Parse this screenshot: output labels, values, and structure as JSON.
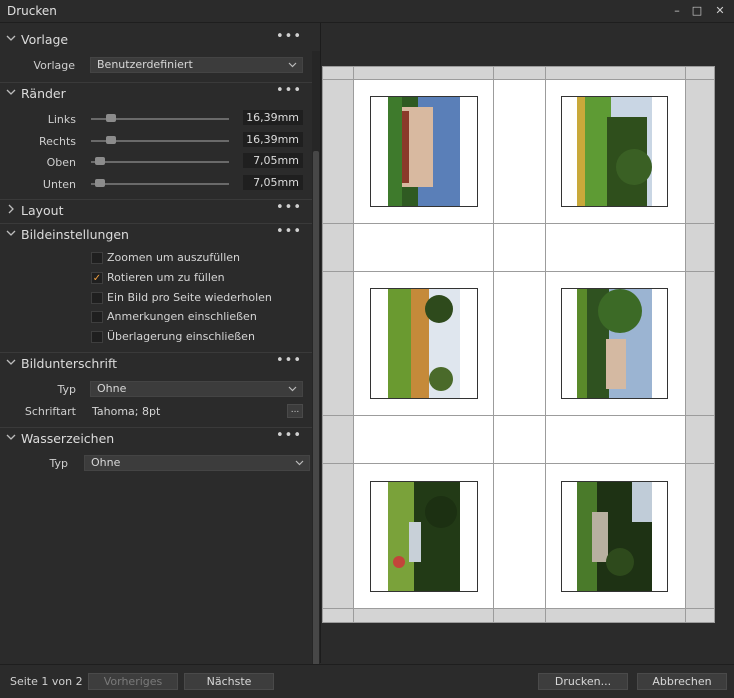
{
  "window": {
    "title": "Drucken",
    "minimize": "–",
    "maximize": "□",
    "close": "✕"
  },
  "panel": {
    "vorlage": {
      "title": "Vorlage",
      "menu": "•••",
      "field_label": "Vorlage",
      "value": "Benutzerdefiniert"
    },
    "raender": {
      "title": "Ränder",
      "menu": "•••",
      "rows": [
        {
          "label": "Links",
          "value": "16,39mm",
          "level": 0.12
        },
        {
          "label": "Rechts",
          "value": "16,39mm",
          "level": 0.12
        },
        {
          "label": "Oben",
          "value": "7,05mm",
          "level": 0.04
        },
        {
          "label": "Unten",
          "value": "7,05mm",
          "level": 0.04
        }
      ]
    },
    "layout": {
      "title": "Layout",
      "menu": "•••"
    },
    "bildeinstellungen": {
      "title": "Bildeinstellungen",
      "menu": "•••",
      "options": [
        {
          "label": "Zoomen um auszufüllen",
          "checked": false
        },
        {
          "label": "Rotieren um zu füllen",
          "checked": true
        },
        {
          "label": "Ein Bild pro Seite wiederholen",
          "checked": false
        },
        {
          "label": "Anmerkungen einschließen",
          "checked": false
        },
        {
          "label": "Überlagerung einschließen",
          "checked": false
        }
      ]
    },
    "bildunterschrift": {
      "title": "Bildunterschrift",
      "menu": "•••",
      "typ_label": "Typ",
      "typ_value": "Ohne",
      "font_label": "Schriftart",
      "font_value": "Tahoma; 8pt",
      "font_button": "..."
    },
    "wasserzeichen": {
      "title": "Wasserzeichen",
      "menu": "•••",
      "typ_label": "Typ",
      "typ_value": "Ohne"
    }
  },
  "footer": {
    "page_info": "Seite 1 von 2",
    "prev": "Vorheriges",
    "next": "Nächste",
    "print": "Drucken...",
    "cancel": "Abbrechen"
  },
  "thumbnails": [
    {
      "name": "photo-manor-house-rotated"
    },
    {
      "name": "photo-garden-trees-rotated"
    },
    {
      "name": "photo-garden-flowers-rotated"
    },
    {
      "name": "photo-manor-house-side-rotated"
    },
    {
      "name": "photo-garden-path-rotated"
    },
    {
      "name": "photo-garden-dark-rotated"
    }
  ],
  "colors": {
    "accent_check": "#f0a040",
    "panel_bg": "#2b2b2b"
  }
}
